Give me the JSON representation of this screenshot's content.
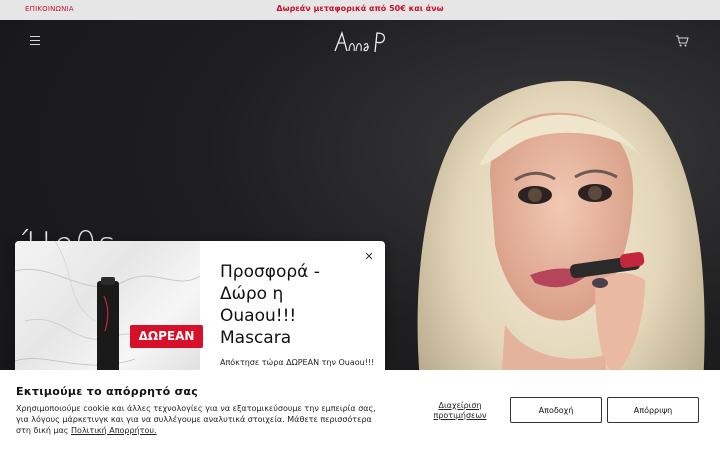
{
  "topbar": {
    "contact_label": "ΕΠΙΚΟΙΝΩΝΙΑ",
    "promo_text": "Δωρεάν μεταφορικά από 50€ και άνω"
  },
  "header": {
    "logo_text": "Anna P",
    "menu_icon": "hamburger-menu-icon",
    "cart_icon": "shopping-cart-icon"
  },
  "hero": {
    "headline": "Ήρθε"
  },
  "popup": {
    "title": "Προσφορά - Δώρο η Ouaou!!! Mascara",
    "subtitle": "Απόκτησε τώρα ΔΩΡΕΑΝ την Ouaou!!!",
    "badge": "ΔΩΡΕΑΝ",
    "close_icon": "close-icon"
  },
  "cookie": {
    "title": "Εκτιμούμε το απόρρητό σας",
    "text": "Χρησιμοποιούμε cookie και άλλες τεχνολογίες για να εξατομικεύσουμε την εμπειρία σας, για λόγους μάρκετινγκ και για να συλλέγουμε αναλυτικά στοιχεία. Μάθετε περισσότερα στη δική μας ",
    "policy_link": "Πολιτική Απορρήτου.",
    "manage_label": "Διαχείριση προτιμήσεων",
    "accept_label": "Αποδοχή",
    "reject_label": "Απόρριψη"
  },
  "colors": {
    "accent_red": "#c8102e",
    "hero_bg": "#1c1c1e"
  }
}
